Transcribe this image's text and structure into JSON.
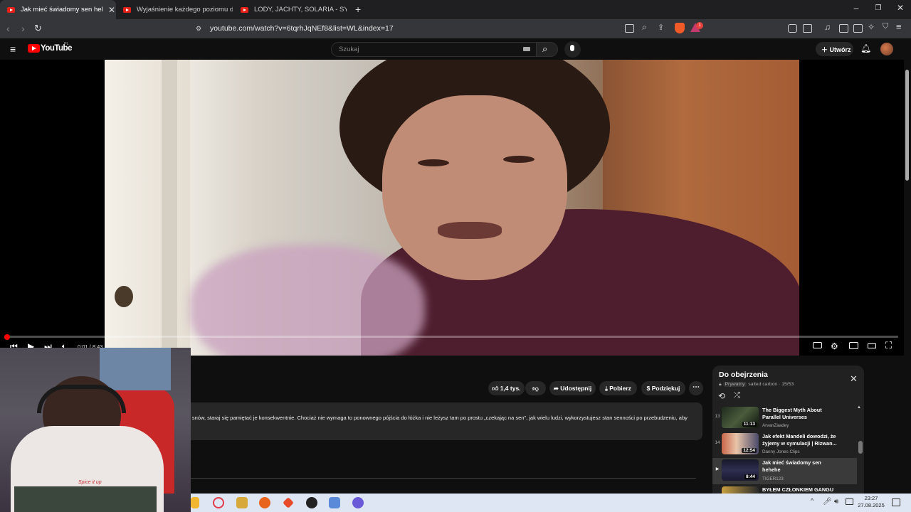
{
  "browser": {
    "tabs": [
      {
        "title": "Jak mieć świadomy sen hehehe",
        "active": true
      },
      {
        "title": "Wyjaśnienie każdego poziomu ducha",
        "active": false
      },
      {
        "title": "LODY, JACHTY, SOLARIA - SYMBOLE",
        "active": false
      }
    ],
    "new_tab": "+",
    "url": "youtube.com/watch?v=6tqrhJqNEf8&list=WL&index=17",
    "badge_count": "1"
  },
  "youtube": {
    "logo": "YouTube",
    "region": "PL",
    "search_placeholder": "Szukaj",
    "create_label": "Utwórz"
  },
  "player": {
    "time": "0:01 / 8:43",
    "progress_fraction": 0.002
  },
  "actions": {
    "likes": "1,4 tys.",
    "share": "Udostępnij",
    "download": "Pobierz",
    "thanks": "Podziękuj",
    "more": "⋯"
  },
  "description": "ie snów, staraj się pamiętać je konsekwentnie. Chociaż nie wymaga to ponownego pójścia do łóżka i nie leżysz tam po prostu „czekając na sen\", jak wielu ludzi, wykorzystujesz stan senności po przebudzeniu, aby",
  "webcam": {
    "shirt_text": "Spice it up"
  },
  "playlist": {
    "title": "Do obejrzenia",
    "privacy": "Prywatny",
    "owner": "salted carbon",
    "position": "15/53",
    "items": [
      {
        "num": "13",
        "title": "The Biggest Myth About Parallel Universes",
        "channel": "ArvanZaadey",
        "duration": "11:13",
        "current": false
      },
      {
        "num": "14",
        "title": "Jak efekt Mandeli dowodzi, że żyjemy w symulacji | Rizwan...",
        "channel": "Danny Jones Clips",
        "duration": "12:54",
        "current": false
      },
      {
        "num": "▶",
        "title": "Jak mieć świadomy sen hehehe",
        "channel": "TIGER123",
        "duration": "8:44",
        "current": true
      },
      {
        "num": "",
        "title": "BYŁEM CZŁONKIEM GANGU",
        "channel": "",
        "duration": "",
        "current": false
      }
    ]
  },
  "taskbar": {
    "time": "23:27",
    "date": "27.08.2025"
  }
}
